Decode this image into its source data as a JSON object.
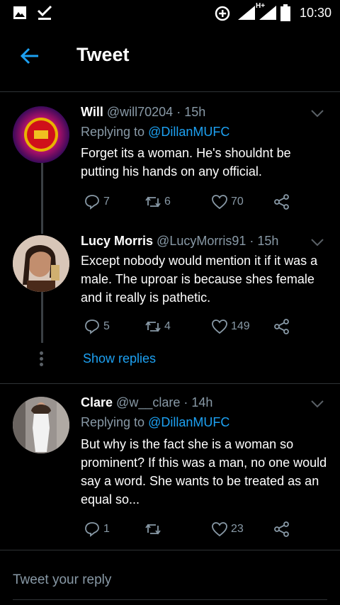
{
  "status_bar": {
    "time": "10:30",
    "network": "H+"
  },
  "header": {
    "title": "Tweet"
  },
  "tweets": [
    {
      "name": "Will",
      "handle": "@will70204",
      "time": "15h",
      "replying_prefix": "Replying to",
      "replying_to": "@DillanMUFC",
      "text": "Forget its a woman. He's shouldnt be putting his hands on any official.",
      "replies": "7",
      "retweets": "6",
      "likes": "70"
    },
    {
      "name": "Lucy Morris",
      "handle": "@LucyMorris91",
      "time": "15h",
      "text": "Except nobody would mention it if it was a male. The uproar is because shes female and it really is pathetic.",
      "replies": "5",
      "retweets": "4",
      "likes": "149"
    },
    {
      "name": "Clare",
      "handle": "@w__clare",
      "time": "14h",
      "replying_prefix": "Replying to",
      "replying_to": "@DillanMUFC",
      "text": "But why is the fact she is a woman so prominent? If this was a man, no one would say a word. She wants to be treated as an equal so...",
      "replies": "1",
      "retweets": "",
      "likes": "23"
    }
  ],
  "show_replies": "Show replies",
  "reply_placeholder": "Tweet your reply",
  "colors": {
    "accent": "#1da1f2",
    "muted": "#8899a6",
    "background": "#000000"
  }
}
